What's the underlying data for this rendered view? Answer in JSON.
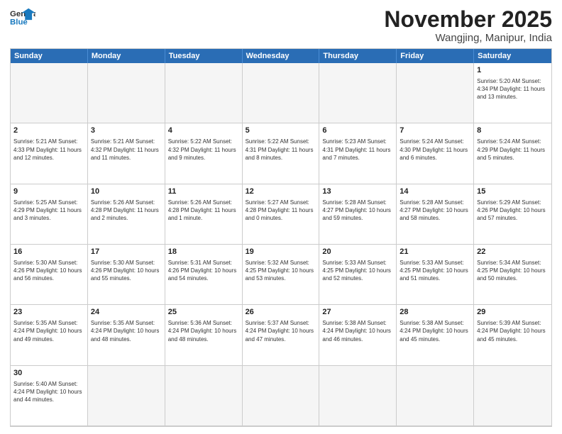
{
  "header": {
    "logo_general": "General",
    "logo_blue": "Blue",
    "month_title": "November 2025",
    "location": "Wangjing, Manipur, India"
  },
  "day_headers": [
    "Sunday",
    "Monday",
    "Tuesday",
    "Wednesday",
    "Thursday",
    "Friday",
    "Saturday"
  ],
  "cells": [
    {
      "day": "",
      "empty": true,
      "info": ""
    },
    {
      "day": "",
      "empty": true,
      "info": ""
    },
    {
      "day": "",
      "empty": true,
      "info": ""
    },
    {
      "day": "",
      "empty": true,
      "info": ""
    },
    {
      "day": "",
      "empty": true,
      "info": ""
    },
    {
      "day": "",
      "empty": true,
      "info": ""
    },
    {
      "day": "1",
      "empty": false,
      "info": "Sunrise: 5:20 AM\nSunset: 4:34 PM\nDaylight: 11 hours\nand 13 minutes."
    },
    {
      "day": "2",
      "empty": false,
      "info": "Sunrise: 5:21 AM\nSunset: 4:33 PM\nDaylight: 11 hours\nand 12 minutes."
    },
    {
      "day": "3",
      "empty": false,
      "info": "Sunrise: 5:21 AM\nSunset: 4:32 PM\nDaylight: 11 hours\nand 11 minutes."
    },
    {
      "day": "4",
      "empty": false,
      "info": "Sunrise: 5:22 AM\nSunset: 4:32 PM\nDaylight: 11 hours\nand 9 minutes."
    },
    {
      "day": "5",
      "empty": false,
      "info": "Sunrise: 5:22 AM\nSunset: 4:31 PM\nDaylight: 11 hours\nand 8 minutes."
    },
    {
      "day": "6",
      "empty": false,
      "info": "Sunrise: 5:23 AM\nSunset: 4:31 PM\nDaylight: 11 hours\nand 7 minutes."
    },
    {
      "day": "7",
      "empty": false,
      "info": "Sunrise: 5:24 AM\nSunset: 4:30 PM\nDaylight: 11 hours\nand 6 minutes."
    },
    {
      "day": "8",
      "empty": false,
      "info": "Sunrise: 5:24 AM\nSunset: 4:29 PM\nDaylight: 11 hours\nand 5 minutes."
    },
    {
      "day": "9",
      "empty": false,
      "info": "Sunrise: 5:25 AM\nSunset: 4:29 PM\nDaylight: 11 hours\nand 3 minutes."
    },
    {
      "day": "10",
      "empty": false,
      "info": "Sunrise: 5:26 AM\nSunset: 4:28 PM\nDaylight: 11 hours\nand 2 minutes."
    },
    {
      "day": "11",
      "empty": false,
      "info": "Sunrise: 5:26 AM\nSunset: 4:28 PM\nDaylight: 11 hours\nand 1 minute."
    },
    {
      "day": "12",
      "empty": false,
      "info": "Sunrise: 5:27 AM\nSunset: 4:28 PM\nDaylight: 11 hours\nand 0 minutes."
    },
    {
      "day": "13",
      "empty": false,
      "info": "Sunrise: 5:28 AM\nSunset: 4:27 PM\nDaylight: 10 hours\nand 59 minutes."
    },
    {
      "day": "14",
      "empty": false,
      "info": "Sunrise: 5:28 AM\nSunset: 4:27 PM\nDaylight: 10 hours\nand 58 minutes."
    },
    {
      "day": "15",
      "empty": false,
      "info": "Sunrise: 5:29 AM\nSunset: 4:26 PM\nDaylight: 10 hours\nand 57 minutes."
    },
    {
      "day": "16",
      "empty": false,
      "info": "Sunrise: 5:30 AM\nSunset: 4:26 PM\nDaylight: 10 hours\nand 56 minutes."
    },
    {
      "day": "17",
      "empty": false,
      "info": "Sunrise: 5:30 AM\nSunset: 4:26 PM\nDaylight: 10 hours\nand 55 minutes."
    },
    {
      "day": "18",
      "empty": false,
      "info": "Sunrise: 5:31 AM\nSunset: 4:26 PM\nDaylight: 10 hours\nand 54 minutes."
    },
    {
      "day": "19",
      "empty": false,
      "info": "Sunrise: 5:32 AM\nSunset: 4:25 PM\nDaylight: 10 hours\nand 53 minutes."
    },
    {
      "day": "20",
      "empty": false,
      "info": "Sunrise: 5:33 AM\nSunset: 4:25 PM\nDaylight: 10 hours\nand 52 minutes."
    },
    {
      "day": "21",
      "empty": false,
      "info": "Sunrise: 5:33 AM\nSunset: 4:25 PM\nDaylight: 10 hours\nand 51 minutes."
    },
    {
      "day": "22",
      "empty": false,
      "info": "Sunrise: 5:34 AM\nSunset: 4:25 PM\nDaylight: 10 hours\nand 50 minutes."
    },
    {
      "day": "23",
      "empty": false,
      "info": "Sunrise: 5:35 AM\nSunset: 4:24 PM\nDaylight: 10 hours\nand 49 minutes."
    },
    {
      "day": "24",
      "empty": false,
      "info": "Sunrise: 5:35 AM\nSunset: 4:24 PM\nDaylight: 10 hours\nand 48 minutes."
    },
    {
      "day": "25",
      "empty": false,
      "info": "Sunrise: 5:36 AM\nSunset: 4:24 PM\nDaylight: 10 hours\nand 48 minutes."
    },
    {
      "day": "26",
      "empty": false,
      "info": "Sunrise: 5:37 AM\nSunset: 4:24 PM\nDaylight: 10 hours\nand 47 minutes."
    },
    {
      "day": "27",
      "empty": false,
      "info": "Sunrise: 5:38 AM\nSunset: 4:24 PM\nDaylight: 10 hours\nand 46 minutes."
    },
    {
      "day": "28",
      "empty": false,
      "info": "Sunrise: 5:38 AM\nSunset: 4:24 PM\nDaylight: 10 hours\nand 45 minutes."
    },
    {
      "day": "29",
      "empty": false,
      "info": "Sunrise: 5:39 AM\nSunset: 4:24 PM\nDaylight: 10 hours\nand 45 minutes."
    },
    {
      "day": "30",
      "empty": false,
      "info": "Sunrise: 5:40 AM\nSunset: 4:24 PM\nDaylight: 10 hours\nand 44 minutes."
    },
    {
      "day": "",
      "empty": true,
      "info": ""
    },
    {
      "day": "",
      "empty": true,
      "info": ""
    },
    {
      "day": "",
      "empty": true,
      "info": ""
    },
    {
      "day": "",
      "empty": true,
      "info": ""
    },
    {
      "day": "",
      "empty": true,
      "info": ""
    },
    {
      "day": "",
      "empty": true,
      "info": ""
    }
  ]
}
